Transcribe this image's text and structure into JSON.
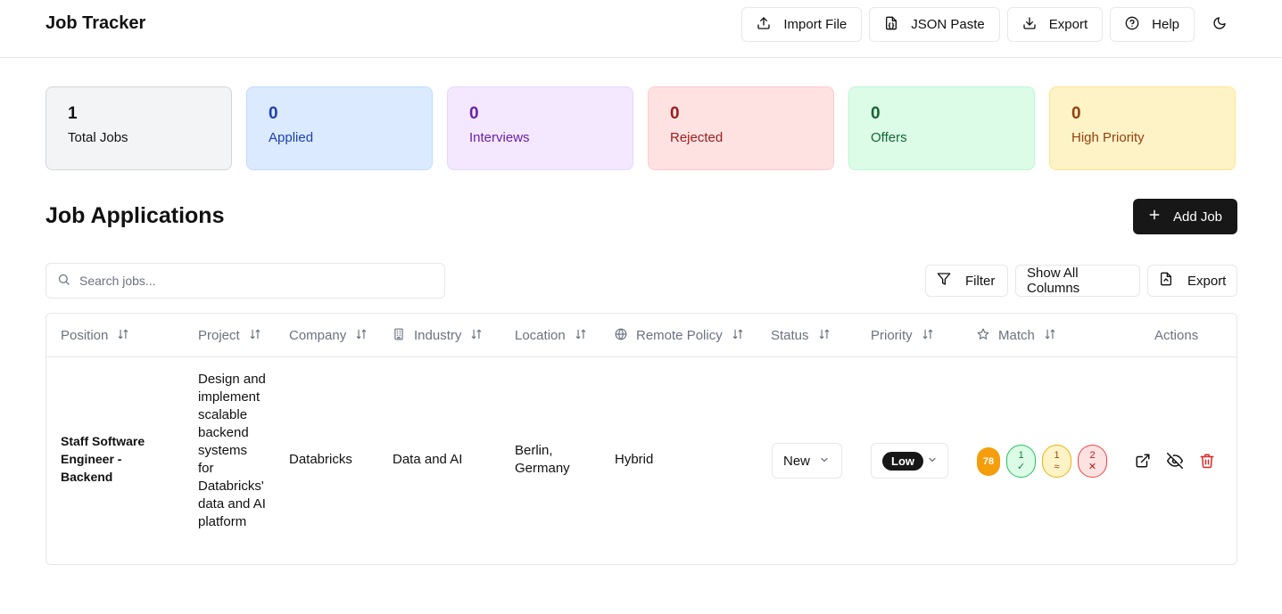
{
  "header": {
    "title": "Job Tracker",
    "buttons": {
      "import": "Import File",
      "json_paste": "JSON Paste",
      "export": "Export",
      "help": "Help"
    }
  },
  "stats": [
    {
      "value": "1",
      "label": "Total Jobs"
    },
    {
      "value": "0",
      "label": "Applied"
    },
    {
      "value": "0",
      "label": "Interviews"
    },
    {
      "value": "0",
      "label": "Rejected"
    },
    {
      "value": "0",
      "label": "Offers"
    },
    {
      "value": "0",
      "label": "High Priority"
    }
  ],
  "colors": {
    "total": "#f3f4f6",
    "applied": "#dbeafe",
    "interviews": "#f3e8ff",
    "rejected": "#fee2e2",
    "offers": "#dcfce7",
    "high_priority": "#fef3c7"
  },
  "section": {
    "title": "Job Applications",
    "add_button": "Add Job"
  },
  "search": {
    "placeholder": "Search jobs...",
    "value": ""
  },
  "toolbar": {
    "filter": "Filter",
    "show_columns": "Show All Columns",
    "export": "Export"
  },
  "table": {
    "columns": {
      "position": "Position",
      "project": "Project",
      "company": "Company",
      "industry": "Industry",
      "location": "Location",
      "remote_policy": "Remote Policy",
      "status": "Status",
      "priority": "Priority",
      "match": "Match",
      "actions": "Actions"
    },
    "rows": [
      {
        "position": "Staff Software Engineer - Backend",
        "project": "Design and implement scalable backend systems for Databricks' data and AI platform",
        "company": "Databricks",
        "industry": "Data and AI",
        "location": "Berlin, Germany",
        "remote_policy": "Hybrid",
        "status": "New",
        "priority": "Low",
        "match": {
          "score": "78",
          "met": "1",
          "met_symbol": "✓",
          "partial": "1",
          "partial_symbol": "≈",
          "missing": "2",
          "missing_symbol": "✕"
        }
      }
    ]
  }
}
